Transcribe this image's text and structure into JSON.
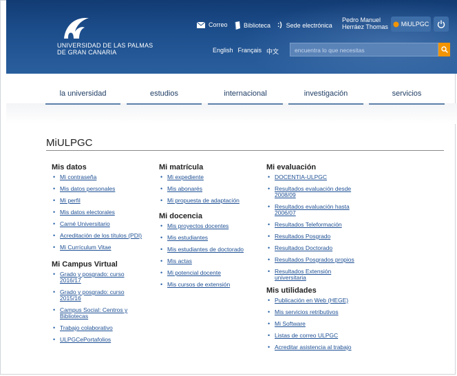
{
  "header": {
    "logo_line1": "UNIVERSIDAD DE LAS PALMAS",
    "logo_line2": "DE GRAN CANARIA",
    "correo": "Correo",
    "biblioteca": "Biblioteca",
    "sede_icon_text": ":)",
    "sede": "Sede electrónica",
    "user_line1": "Pedro Manuel",
    "user_line2": "Herráez Thomas",
    "miulpgc_btn": "MiULPGC",
    "lang_en": "English",
    "lang_fr": "Français",
    "lang_zh": "中文",
    "search_placeholder": "encuentra lo que necesitas"
  },
  "nav": [
    "la universidad",
    "estudios",
    "internacional",
    "investigación",
    "servicios"
  ],
  "page_title": "MiULPGC",
  "col1": {
    "sec1": "Mis datos",
    "items1": [
      "Mi contraseña",
      "Mis datos personales",
      "Mi perfil",
      "Mis datos electorales",
      "Carné Universitario",
      "Acreditación de los títulos (PDI)",
      "Mi Currículum Vitae"
    ],
    "sec2": "Mi Campus Virtual",
    "items2": [
      "Grado y posgrado: curso 2016/17",
      "Grado y posgrado: curso 2015/16",
      "Campus Social: Centros y Bibliotecas",
      "Trabajo colaborativo",
      "ULPGCePortafolios"
    ]
  },
  "col2": {
    "sec1": "Mi matrícula",
    "items1": [
      "Mi expediente",
      "Mis abonarés",
      "Mi propuesta de adaptación"
    ],
    "sec2": "Mi docencia",
    "items2": [
      "Mis proyectos docentes",
      "Mis estudiantes",
      "Mis estudiantes de doctorado",
      "Mis actas",
      "Mi potencial docente",
      "Mis cursos de extensión"
    ]
  },
  "col3": {
    "sec1": "Mi evaluación",
    "items1": [
      "DOCENTIA-ULPGC",
      "Resultados evaluación desde 2008/09",
      "Resultados evaluación hasta 2006/07",
      "Resultados Teleformación",
      "Resultados Posgrado",
      "Resultados Doctorado",
      "Resultados Posgrados propios",
      "Resultados Extensión universitaria"
    ],
    "sec2": "Mis utilidades",
    "items2": [
      "Publicación en Web (HEGE)",
      "Mis servicios retributivos",
      "Mi Software",
      "Listas de correo ULPGC",
      "Acreditar asistencia al trabajo"
    ]
  },
  "colors": {
    "header": "#1c4d8b",
    "accent": "#f29400",
    "link": "#1d4f94"
  }
}
